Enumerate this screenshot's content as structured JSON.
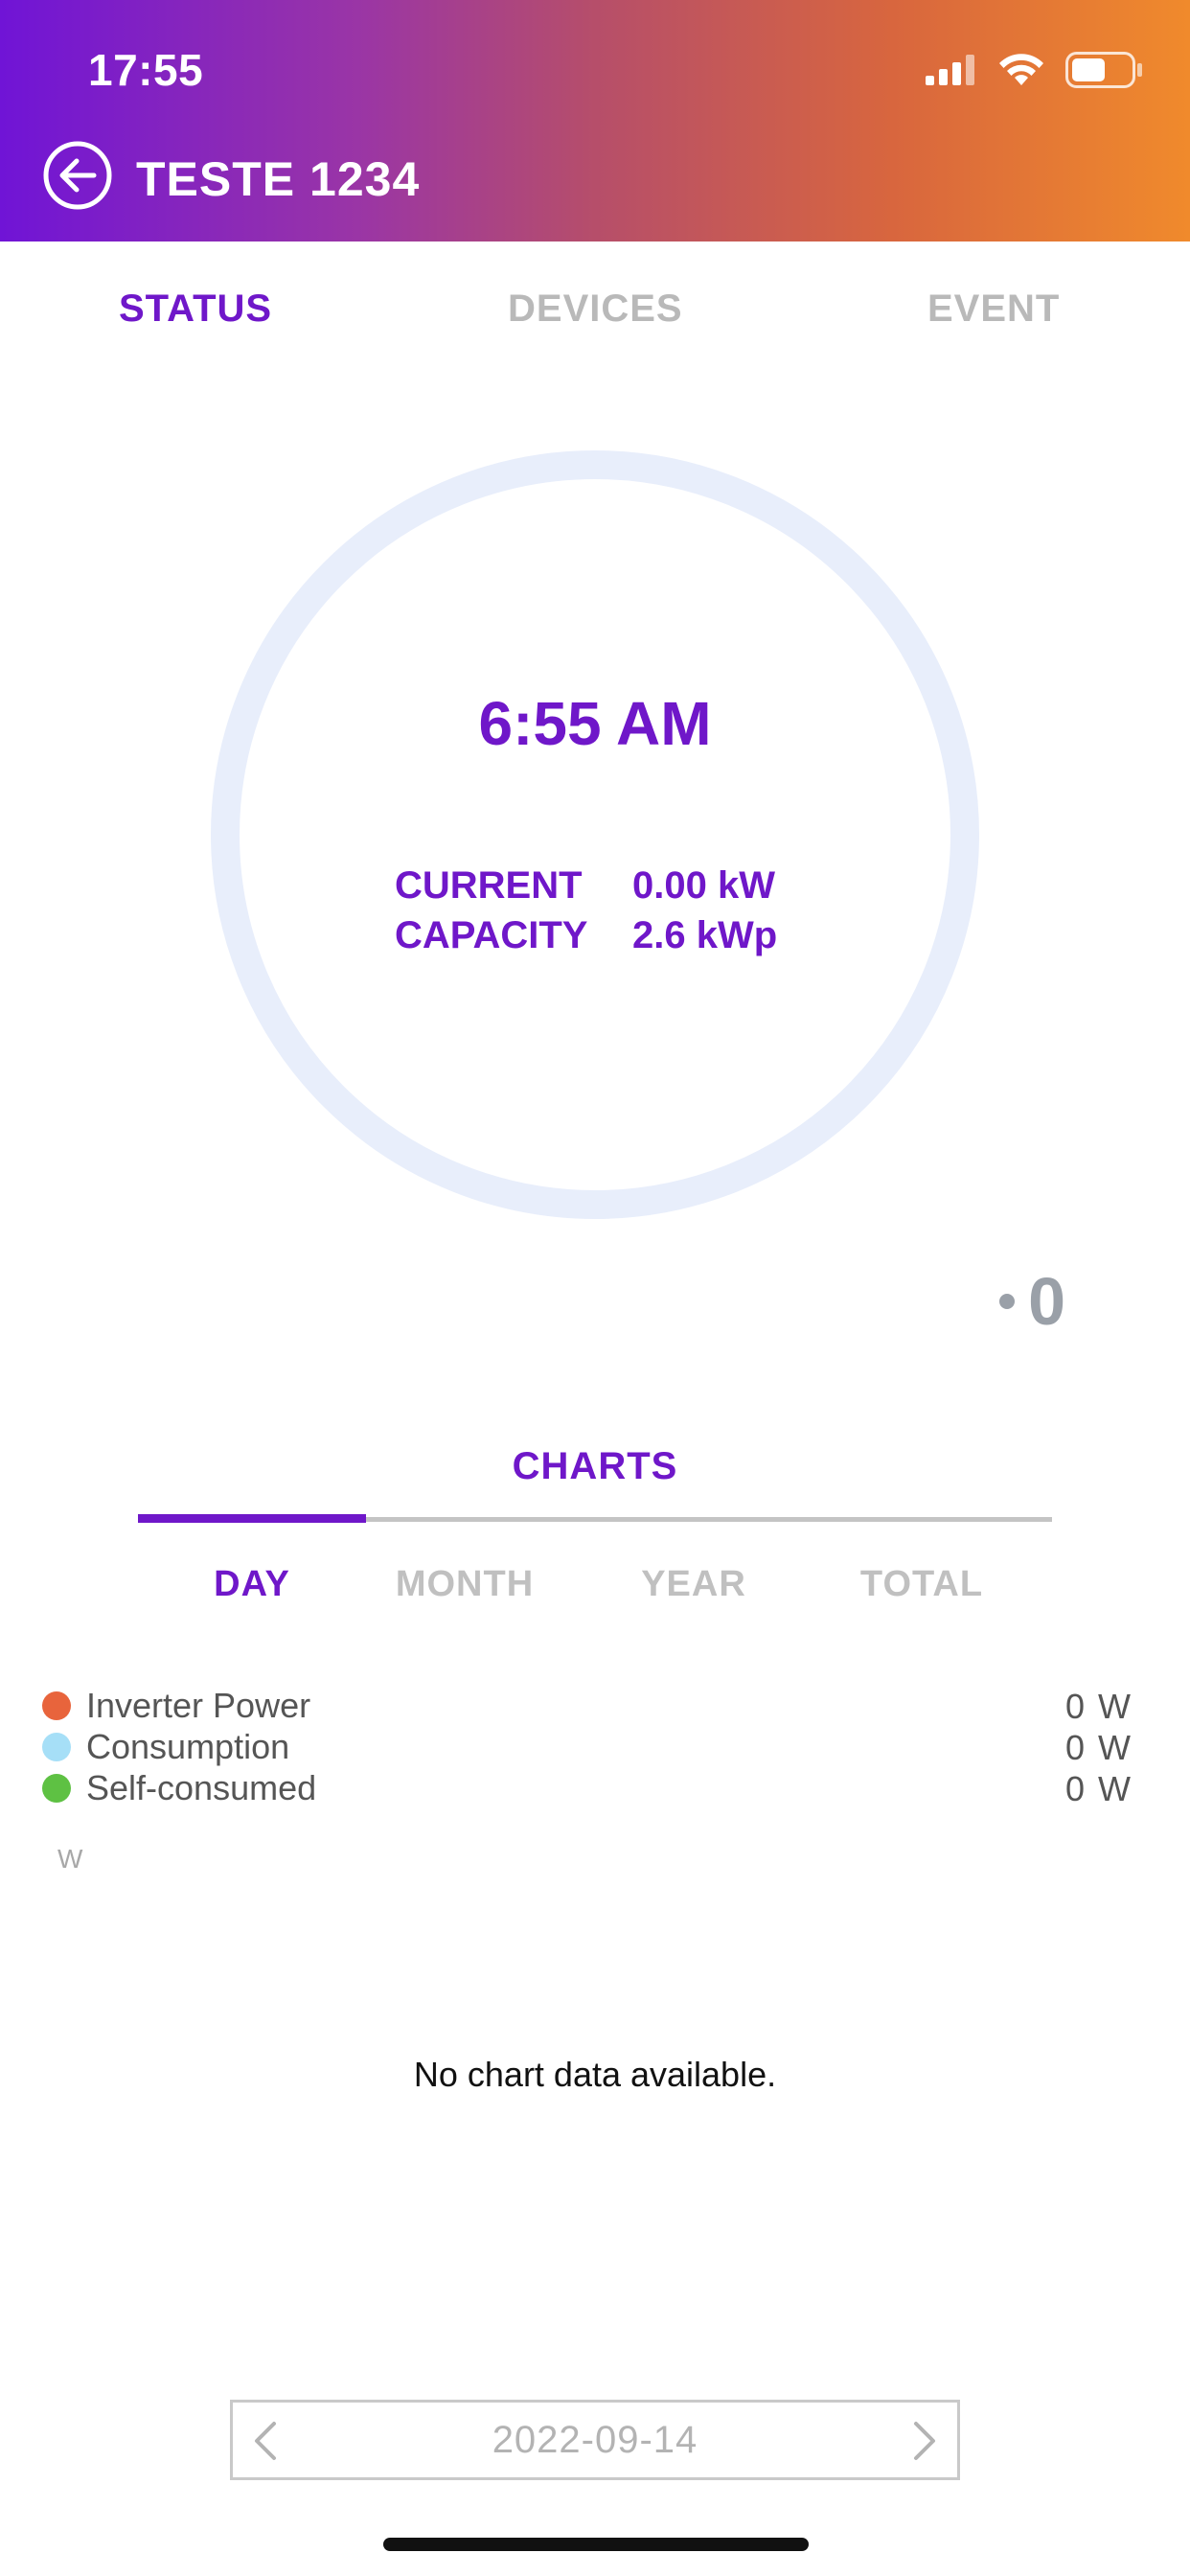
{
  "status_bar": {
    "time": "17:55",
    "icons": [
      "signal-icon",
      "wifi-icon",
      "battery-icon"
    ]
  },
  "header": {
    "title": "TESTE 1234",
    "back_icon": "back-arrow-circle-icon",
    "gradient_colors": [
      "#7014d6",
      "#f08a2c"
    ]
  },
  "tabs": [
    {
      "label": "STATUS",
      "active": true
    },
    {
      "label": "DEVICES",
      "active": false
    },
    {
      "label": "EVENT",
      "active": false
    }
  ],
  "status": {
    "time": "6:55 AM",
    "current_label": "CURRENT",
    "current_value": "0.00 kW",
    "capacity_label": "CAPACITY",
    "capacity_value": "2.6 kWp",
    "counter": "0"
  },
  "charts": {
    "title": "CHARTS",
    "periods": [
      {
        "label": "DAY",
        "active": true
      },
      {
        "label": "MONTH",
        "active": false
      },
      {
        "label": "YEAR",
        "active": false
      },
      {
        "label": "TOTAL",
        "active": false
      }
    ],
    "legend": [
      {
        "name": "Inverter Power",
        "value": "0",
        "unit": "W",
        "color": "#e8643c"
      },
      {
        "name": "Consumption",
        "value": "0",
        "unit": "W",
        "color": "#a6dff7"
      },
      {
        "name": "Self-consumed",
        "value": "0",
        "unit": "W",
        "color": "#5ec143"
      }
    ],
    "axis_unit": "W",
    "empty_message": "No chart data available."
  },
  "date_picker": {
    "date": "2022-09-14"
  },
  "colors": {
    "accent": "#6f17c9",
    "inactive": "#b9b9b9",
    "ring": "#e8eefb"
  }
}
